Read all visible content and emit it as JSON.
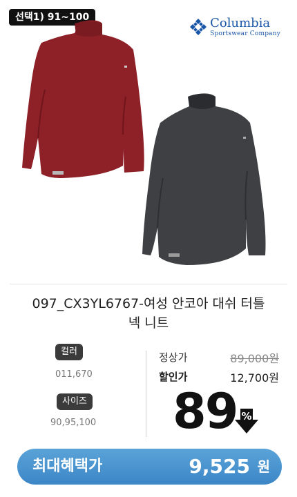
{
  "option_tag": "선택1) 91~100",
  "brand": {
    "name": "Columbia",
    "subtitle": "Sportswear Company",
    "color": "#1a56a8"
  },
  "product": {
    "title_line1": "097_CX3YL6767-여성 안코아 대쉬 터틀",
    "title_line2": "넥 니트",
    "color_red": "#8e2028",
    "color_gray": "#3f4044"
  },
  "options": {
    "color_label": "컬러",
    "color_values": "011,670",
    "size_label": "사이즈",
    "size_values": "90,95,100"
  },
  "price": {
    "regular_label": "정상가",
    "regular_value": "89,000원",
    "sale_label": "할인가",
    "sale_value": "12,700원",
    "discount_number": "89",
    "discount_symbol": "%"
  },
  "benefit": {
    "label": "최대혜택가",
    "value": "9,525",
    "unit": "원",
    "color": "#4a95d0"
  }
}
